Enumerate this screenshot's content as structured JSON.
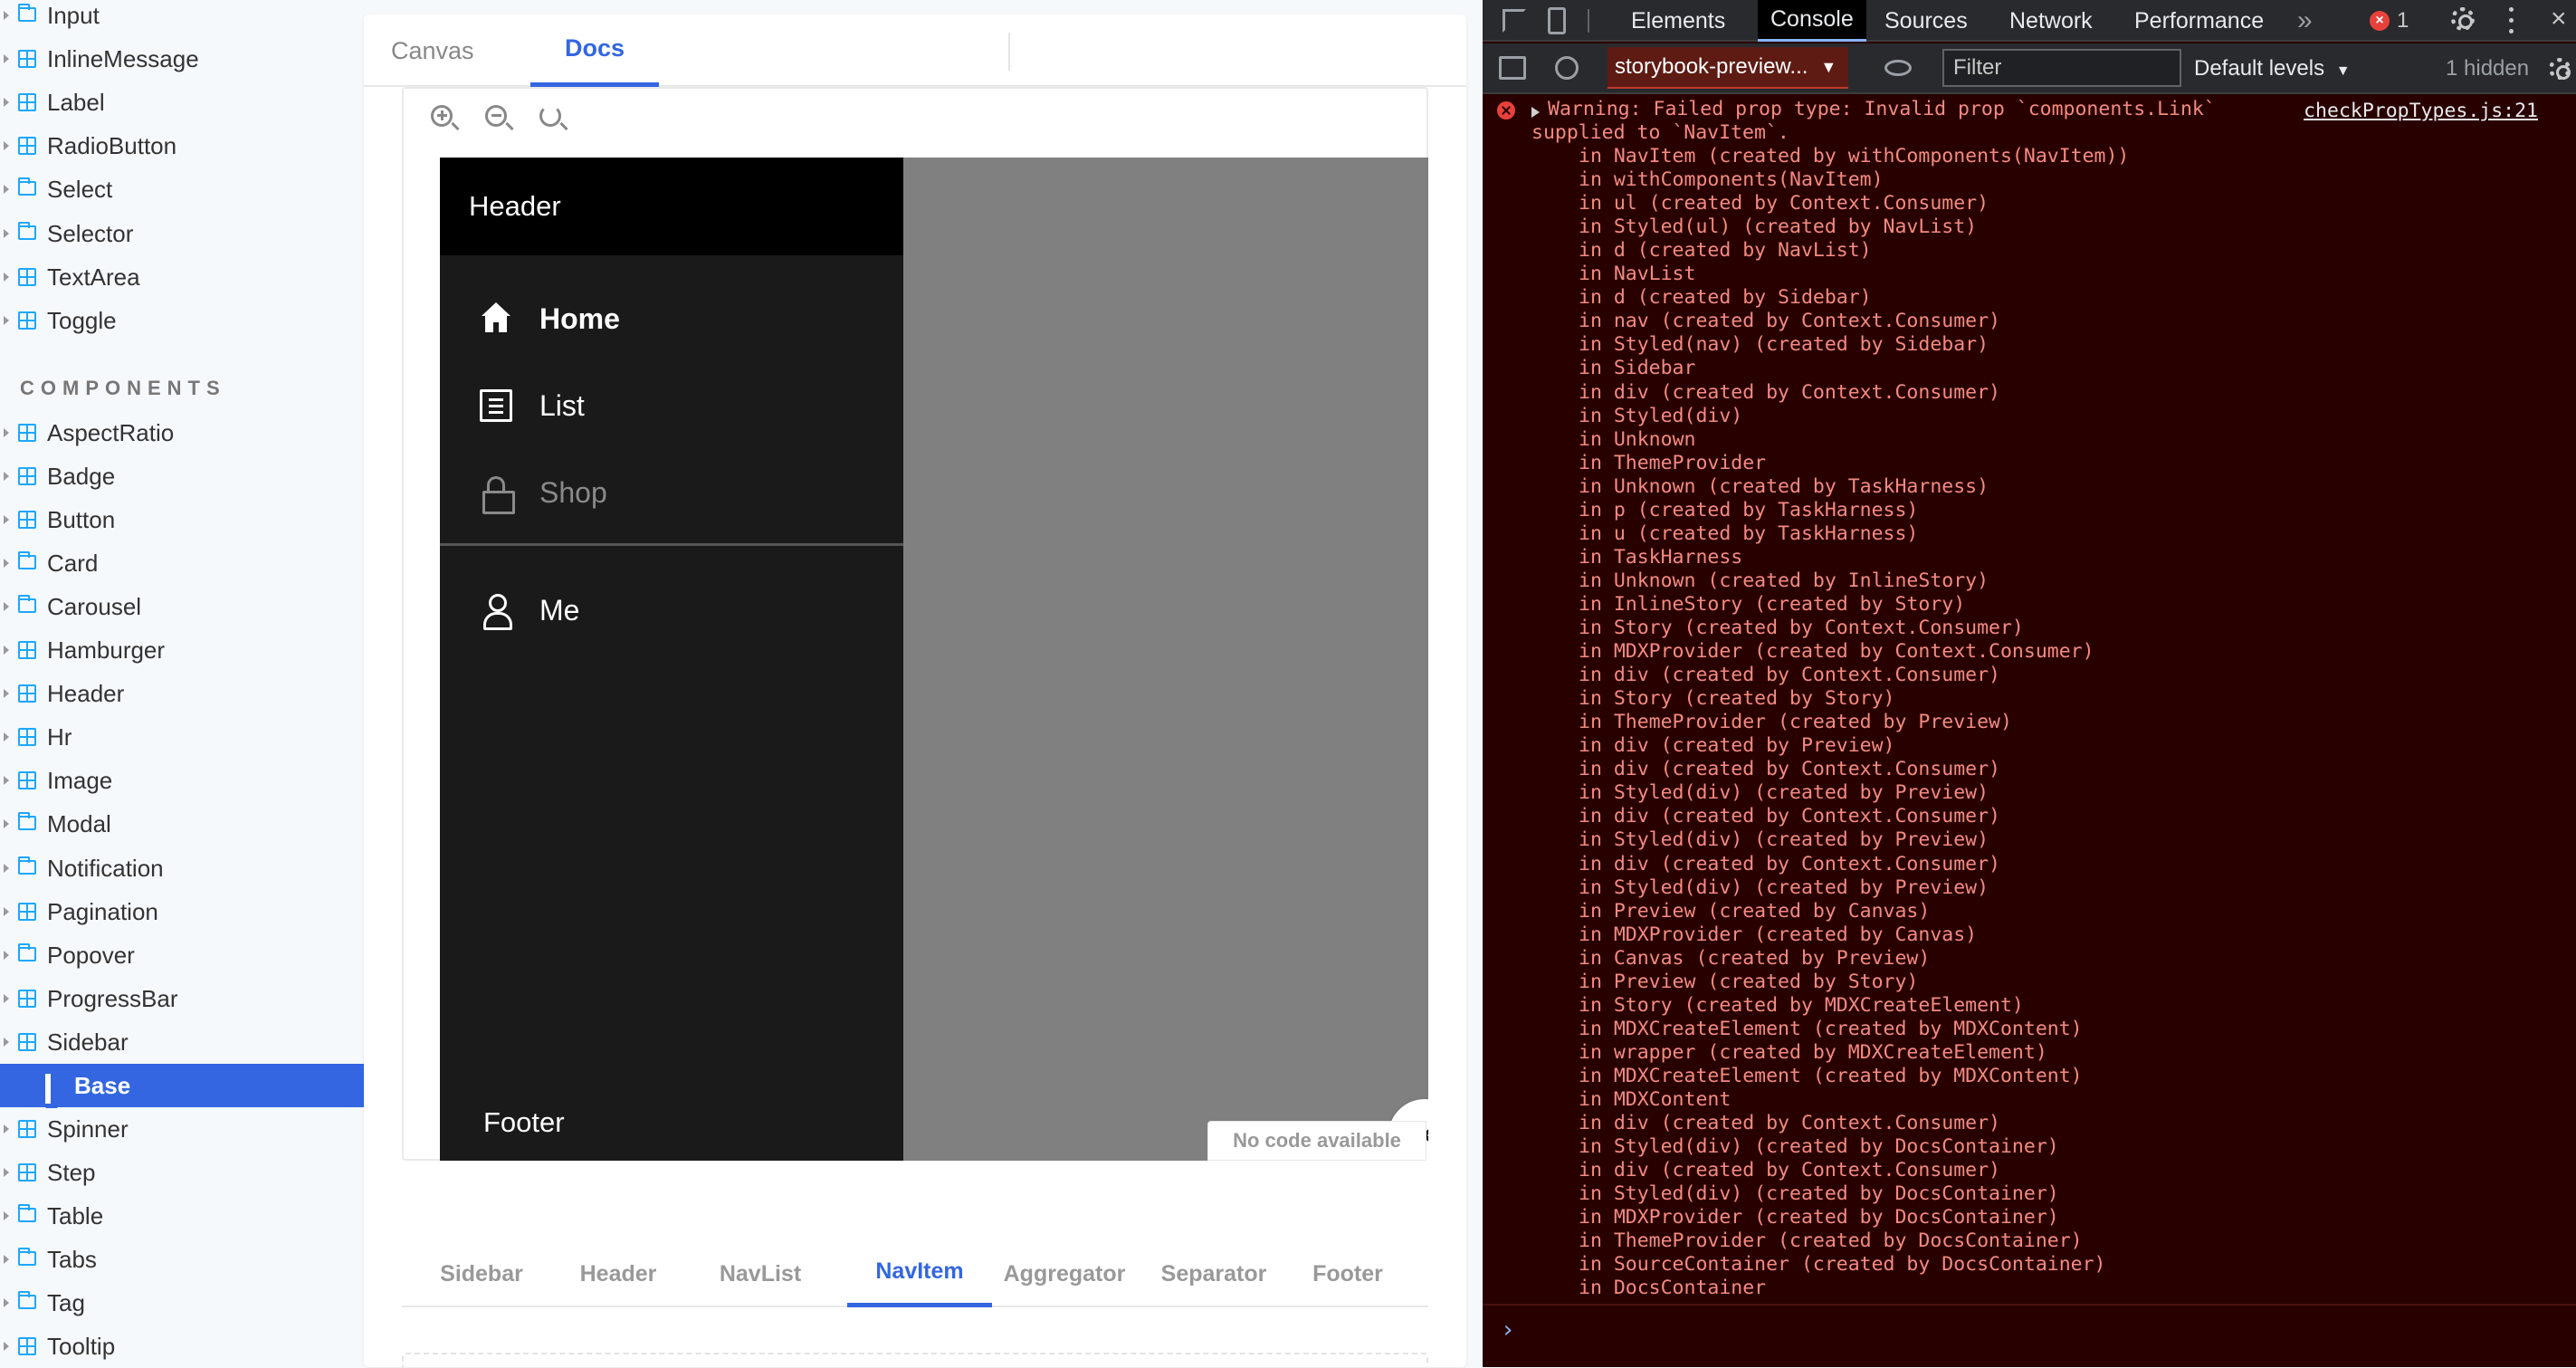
{
  "sidebar": {
    "items": [
      {
        "label": "Input",
        "type": "folder"
      },
      {
        "label": "InlineMessage",
        "type": "component"
      },
      {
        "label": "Label",
        "type": "component"
      },
      {
        "label": "RadioButton",
        "type": "component"
      },
      {
        "label": "Select",
        "type": "folder"
      },
      {
        "label": "Selector",
        "type": "folder"
      },
      {
        "label": "TextArea",
        "type": "component"
      },
      {
        "label": "Toggle",
        "type": "component"
      }
    ],
    "section_title": "COMPONENTS",
    "components": [
      {
        "label": "AspectRatio",
        "type": "component"
      },
      {
        "label": "Badge",
        "type": "component"
      },
      {
        "label": "Button",
        "type": "component"
      },
      {
        "label": "Card",
        "type": "folder"
      },
      {
        "label": "Carousel",
        "type": "folder"
      },
      {
        "label": "Hamburger",
        "type": "component"
      },
      {
        "label": "Header",
        "type": "component"
      },
      {
        "label": "Hr",
        "type": "component"
      },
      {
        "label": "Image",
        "type": "component"
      },
      {
        "label": "Modal",
        "type": "folder"
      },
      {
        "label": "Notification",
        "type": "folder"
      },
      {
        "label": "Pagination",
        "type": "component"
      },
      {
        "label": "Popover",
        "type": "folder"
      },
      {
        "label": "ProgressBar",
        "type": "component"
      },
      {
        "label": "Sidebar",
        "type": "component"
      },
      {
        "label": "Base",
        "type": "story",
        "selected": true
      },
      {
        "label": "Spinner",
        "type": "component"
      },
      {
        "label": "Step",
        "type": "component"
      },
      {
        "label": "Table",
        "type": "folder"
      },
      {
        "label": "Tabs",
        "type": "folder"
      },
      {
        "label": "Tag",
        "type": "folder"
      },
      {
        "label": "Tooltip",
        "type": "component"
      }
    ]
  },
  "main": {
    "tabs": [
      {
        "label": "Canvas",
        "active": false
      },
      {
        "label": "Docs",
        "active": true
      }
    ],
    "preview": {
      "header": "Header",
      "nav": [
        {
          "label": "Home",
          "icon": "home-icon"
        },
        {
          "label": "List",
          "icon": "list-icon"
        },
        {
          "label": "Shop",
          "icon": "lock-icon"
        }
      ],
      "me": {
        "label": "Me",
        "icon": "user-icon"
      },
      "footer": "Footer",
      "no_code": "No code available"
    },
    "sub_tabs": [
      {
        "label": "Sidebar",
        "active": false
      },
      {
        "label": "Header",
        "active": false
      },
      {
        "label": "NavList",
        "active": false
      },
      {
        "label": "NavItem",
        "active": true
      },
      {
        "label": "Aggregator",
        "active": false
      },
      {
        "label": "Separator",
        "active": false
      },
      {
        "label": "Footer",
        "active": false
      }
    ]
  },
  "devtools": {
    "tabs": [
      "Elements",
      "Console",
      "Sources",
      "Network",
      "Performance"
    ],
    "active_tab": "Console",
    "overflow": "»",
    "error_count": "1",
    "context": "storybook-preview...",
    "filter_placeholder": "Filter",
    "levels": "Default levels",
    "hidden": "1 hidden",
    "console": {
      "message_line1": "Warning: Failed prop type: Invalid prop `components.Link`",
      "message_line2": "supplied to `NavItem`.",
      "source_link": "checkPropTypes.js:21",
      "stack": [
        "in NavItem (created by withComponents(NavItem))",
        "in withComponents(NavItem)",
        "in ul (created by Context.Consumer)",
        "in Styled(ul) (created by NavList)",
        "in d (created by NavList)",
        "in NavList",
        "in d (created by Sidebar)",
        "in nav (created by Context.Consumer)",
        "in Styled(nav) (created by Sidebar)",
        "in Sidebar",
        "in div (created by Context.Consumer)",
        "in Styled(div)",
        "in Unknown",
        "in ThemeProvider",
        "in Unknown (created by TaskHarness)",
        "in p (created by TaskHarness)",
        "in u (created by TaskHarness)",
        "in TaskHarness",
        "in Unknown (created by InlineStory)",
        "in InlineStory (created by Story)",
        "in Story (created by Context.Consumer)",
        "in MDXProvider (created by Context.Consumer)",
        "in div (created by Context.Consumer)",
        "in Story (created by Story)",
        "in ThemeProvider (created by Preview)",
        "in div (created by Preview)",
        "in div (created by Context.Consumer)",
        "in Styled(div) (created by Preview)",
        "in div (created by Context.Consumer)",
        "in Styled(div) (created by Preview)",
        "in div (created by Context.Consumer)",
        "in Styled(div) (created by Preview)",
        "in Preview (created by Canvas)",
        "in MDXProvider (created by Canvas)",
        "in Canvas (created by Preview)",
        "in Preview (created by Story)",
        "in Story (created by MDXCreateElement)",
        "in MDXCreateElement (created by MDXContent)",
        "in wrapper (created by MDXCreateElement)",
        "in MDXCreateElement (created by MDXContent)",
        "in MDXContent",
        "in div (created by Context.Consumer)",
        "in Styled(div) (created by DocsContainer)",
        "in div (created by Context.Consumer)",
        "in Styled(div) (created by DocsContainer)",
        "in MDXProvider (created by DocsContainer)",
        "in ThemeProvider (created by DocsContainer)",
        "in SourceContainer (created by DocsContainer)",
        "in DocsContainer"
      ],
      "prompt": "›"
    }
  },
  "colors": {
    "accent": "#3366e0",
    "storybook_blue": "#1ea7fd",
    "console_error_bg": "#290000",
    "console_error_text": "#f28b82"
  }
}
